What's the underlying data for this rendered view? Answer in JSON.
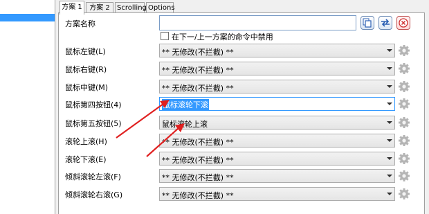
{
  "tabs": [
    {
      "label": "方案 1"
    },
    {
      "label": "方案 2"
    },
    {
      "label": "Scrolling"
    },
    {
      "label": "Options"
    }
  ],
  "scheme": {
    "label": "方案名称",
    "name_value": "",
    "disable_checkbox_label": "在下一/上一方案的命令中禁用",
    "disable_checked": false
  },
  "mappings": [
    {
      "label": "鼠标左键(L)",
      "value": "** 无修改(不拦截) **"
    },
    {
      "label": "鼠标右键(R)",
      "value": "** 无修改(不拦截) **"
    },
    {
      "label": "鼠标中键(M)",
      "value": "** 无修改(不拦截) **"
    },
    {
      "label": "鼠标第四按钮(4)",
      "value": "鼠标滚轮下滚"
    },
    {
      "label": "鼠标第五按钮(5)",
      "value": "鼠标滚轮上滚"
    },
    {
      "label": "滚轮上滚(H)",
      "value": "** 无修改(不拦截) **"
    },
    {
      "label": "滚轮下滚(E)",
      "value": "** 无修改(不拦截) **"
    },
    {
      "label": "倾斜滚轮左滚(F)",
      "value": "** 无修改(不拦截) **"
    },
    {
      "label": "倾斜滚轮右滚(G)",
      "value": "** 无修改(不拦截) **"
    }
  ],
  "icons": {
    "copy": "copy-icon",
    "swap": "swap-arrows-icon",
    "delete": "delete-x-icon",
    "settings": "gear-icon"
  },
  "colors": {
    "selection": "#3399ff",
    "annotation_arrow": "#e02020",
    "delete_red": "#d03030",
    "swap_blue": "#2b5fb3"
  }
}
